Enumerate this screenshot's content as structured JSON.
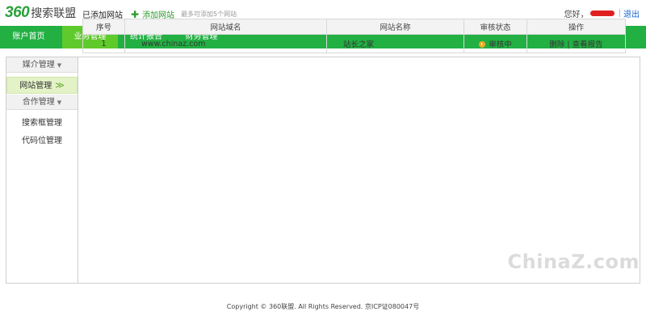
{
  "header": {
    "logo_number": "360",
    "logo_text": "搜索联盟",
    "greeting": "您好，",
    "separator": "|",
    "logout": "退出"
  },
  "nav": [
    {
      "label": "账户首页",
      "active": false
    },
    {
      "label": "业务管理",
      "active": true
    },
    {
      "label": "统计报告",
      "active": false
    },
    {
      "label": "财务管理",
      "active": false
    }
  ],
  "sidebar": {
    "media_group": "媒介管理",
    "website_manage": "网站管理",
    "website_manage_chevron": "≫",
    "coop_group": "合作管理",
    "search_box": "搜索框管理",
    "code_slot": "代码位管理",
    "dropdown_glyph": "▼"
  },
  "content": {
    "title": "已添加网站",
    "add_label": "添加网站",
    "hint": "最多可添加5个网站"
  },
  "table": {
    "headers": [
      "序号",
      "网站域名",
      "网站名称",
      "审核状态",
      "操作"
    ],
    "rows": [
      {
        "index": "1",
        "domain": "www.chinaz.com",
        "name": "站长之家",
        "status": "审核中",
        "op_delete": "删除",
        "op_sep": "|",
        "op_report": "查看报告"
      }
    ]
  },
  "footer": {
    "copyright": "Copyright © 360联盟. All Rights Reserved. 京ICP证080047号"
  },
  "watermark": "ChinaZ.com",
  "colors": {
    "nav_bg": "#22b043",
    "nav_active": "#5fca2b",
    "brand_green": "#2aa03a",
    "status_pending": "#f2a92a"
  }
}
